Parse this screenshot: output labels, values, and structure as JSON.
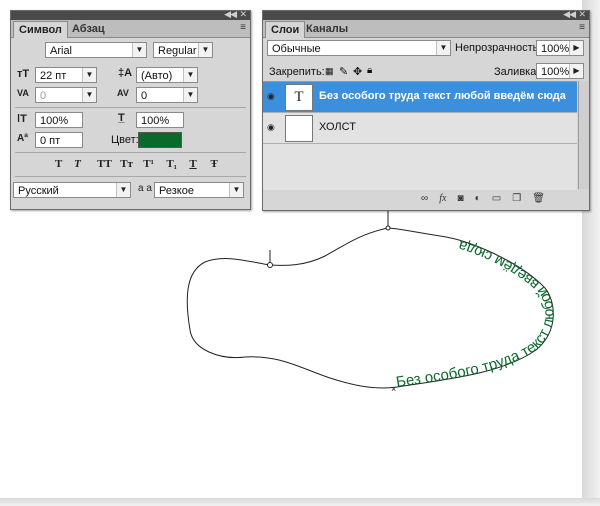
{
  "character_panel": {
    "tabs": [
      "Символ",
      "Абзац"
    ],
    "font_family": "Arial",
    "font_style": "Regular",
    "font_size": "22 пт",
    "leading": "(Авто)",
    "kerning": "0",
    "tracking": "0",
    "vertical_scale": "100%",
    "horizontal_scale": "100%",
    "baseline_shift": "0 пт",
    "color_label": "Цвет:",
    "color_value": "#0a6a2c",
    "style_buttons": [
      "T",
      "T",
      "TT",
      "Tт",
      "T¹",
      "T₁",
      "T",
      "Ŧ"
    ],
    "language": "Русский",
    "antialias_prefix": "a a",
    "antialias": "Резкое"
  },
  "layers_panel": {
    "tabs": [
      "Слои",
      "Каналы"
    ],
    "blend_mode": "Обычные",
    "opacity_label": "Непрозрачность:",
    "opacity_value": "100%",
    "lock_label": "Закрепить:",
    "fill_label": "Заливка:",
    "fill_value": "100%",
    "layers": [
      {
        "name": "Без особого труда текст любой введём сюда",
        "thumb": "T",
        "selected": true
      },
      {
        "name": "ХОЛСТ",
        "thumb": "",
        "selected": false
      }
    ]
  },
  "canvas": {
    "path_text": "Без особого труда текст любой введём сюда",
    "text_color": "#0a6a2c"
  }
}
